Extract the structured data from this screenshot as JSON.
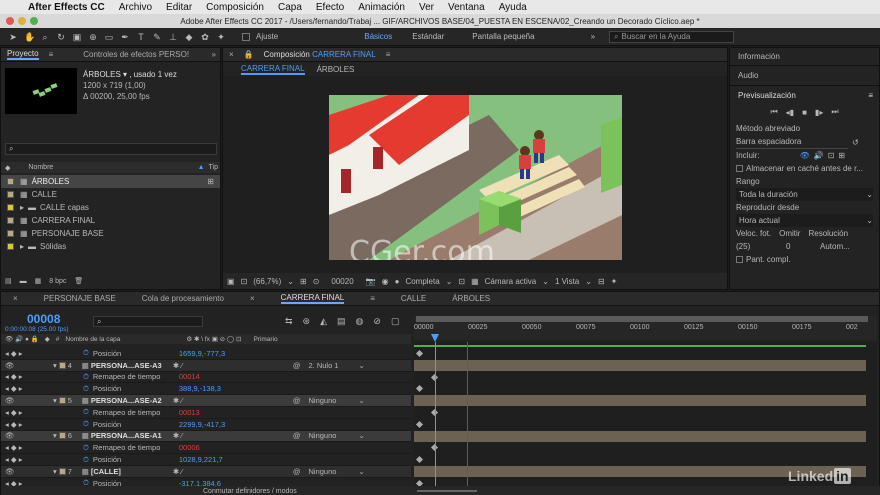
{
  "menubar": {
    "apple": "",
    "app": "After Effects CC",
    "items": [
      "Archivo",
      "Editar",
      "Composición",
      "Capa",
      "Efecto",
      "Animación",
      "Ver",
      "Ventana",
      "Ayuda"
    ]
  },
  "titlebar": {
    "title": "Adobe After Effects CC 2017 - /Users/fernando/Trabaj ... GIF/ARCHIVOS BASE/04_PUESTA EN ESCENA/02_Creando un Decorado Cíclico.aep *"
  },
  "toolbar": {
    "ajuste": "Ajuste",
    "workspaces": [
      "Básicos",
      "Estándar",
      "Pantalla pequeña"
    ],
    "search_placeholder": "Buscar en la Ayuda"
  },
  "project": {
    "tab": "Proyecto",
    "effects_tab": "Controles de efectos PERSO!",
    "item_name": "ÁRBOLES ▾ , usado 1 vez",
    "item_dims": "1200 x 719 (1,00)",
    "item_dur": "Δ 00200, 25,00 fps",
    "col_name": "Nombre",
    "col_type": "Tip",
    "items": [
      "ÁRBOLES",
      "CALLE",
      "CALLE capas",
      "CARRERA FINAL",
      "PERSONAJE BASE",
      "Sólidas"
    ],
    "bpc": "8 bpc"
  },
  "comp": {
    "tab_prefix": "Composición",
    "tab_name": "CARRERA FINAL",
    "crumbs": [
      "CARRERA FINAL",
      "ÁRBOLES"
    ],
    "zoom": "(66,7%)",
    "timecode": "00020",
    "quality": "Completa",
    "camera": "Cámara activa",
    "view": "1 Vista",
    "watermark": "CGer.com"
  },
  "right": {
    "info": "Información",
    "audio": "Audio",
    "preview": "Previsualización",
    "shortcut_label": "Método abreviado",
    "shortcut": "Barra espaciadora",
    "incluir": "Incluir:",
    "cache": "Almacenar en caché antes de r...",
    "rango": "Rango",
    "rango_val": "Toda la duración",
    "reproducir": "Reproducir desde",
    "reproducir_val": "Hora actual",
    "fps_label": "Veloc. fot.",
    "omitir": "Omitir",
    "resolucion": "Resolución",
    "fps_val": "(25)",
    "omitir_val": "0",
    "res_val": "Autom...",
    "pant": "Pant. compl."
  },
  "timeline": {
    "tabs": [
      "PERSONAJE BASE",
      "Cola de procesamiento",
      "CARRERA FINAL",
      "CALLE",
      "ÁRBOLES"
    ],
    "timecode": "00008",
    "fps": "0:00:00:08 (25.00 fps)",
    "col_name": "Nombre de la capa",
    "col_parent": "Primario",
    "ruler": [
      "00000",
      "00025",
      "00050",
      "00075",
      "00100",
      "00125",
      "00150",
      "00175",
      "002"
    ],
    "footer": "Conmutar definidores / modos",
    "rows": [
      {
        "kind": "prop",
        "label": "Posición",
        "value": "1659,9,-777,3",
        "vcolor": "blue"
      },
      {
        "kind": "layer",
        "num": "4",
        "label": "PERSONA...ASE-A3",
        "parent": "2. Nulo 1"
      },
      {
        "kind": "prop",
        "label": "Remapeo de tiempo",
        "value": "00014",
        "vcolor": "red"
      },
      {
        "kind": "prop",
        "label": "Posición",
        "value": "388,9,-138,3",
        "vcolor": "blue"
      },
      {
        "kind": "layer",
        "num": "5",
        "label": "PERSONA...ASE-A2",
        "parent": "Ninguno",
        "sel": true
      },
      {
        "kind": "prop",
        "label": "Remapeo de tiempo",
        "value": "00013",
        "vcolor": "red"
      },
      {
        "kind": "prop",
        "label": "Posición",
        "value": "2299,9,-417,3",
        "vcolor": "blue"
      },
      {
        "kind": "layer",
        "num": "6",
        "label": "PERSONA...ASE-A1",
        "parent": "Ninguno",
        "sel": true
      },
      {
        "kind": "prop",
        "label": "Remapeo de tiempo",
        "value": "00006",
        "vcolor": "red"
      },
      {
        "kind": "prop",
        "label": "Posición",
        "value": "1028,9,221,7",
        "vcolor": "blue"
      },
      {
        "kind": "layer",
        "num": "7",
        "label": "[CALLE]",
        "parent": "Ninguno"
      },
      {
        "kind": "prop",
        "label": "Posición",
        "value": "-317,1,384,6",
        "vcolor": "blue"
      }
    ]
  },
  "linkedin": "Linked"
}
